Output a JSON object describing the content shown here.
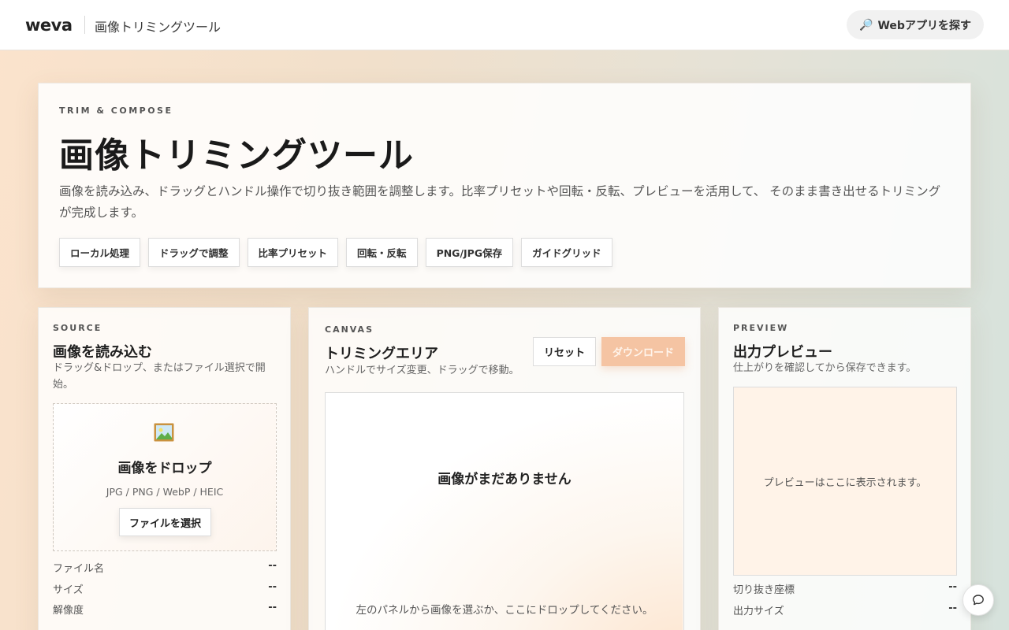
{
  "header": {
    "logo": "weva",
    "app_title": "画像トリミングツール",
    "explore_label": "Webアプリを探す",
    "explore_icon": "magnifier-icon"
  },
  "hero": {
    "eyebrow": "TRIM & COMPOSE",
    "title": "画像トリミングツール",
    "description": "画像を読み込み、ドラッグとハンドル操作で切り抜き範囲を調整します。比率プリセットや回転・反転、プレビューを活用して、 そのまま書き出せるトリミングが完成します。",
    "chips": [
      "ローカル処理",
      "ドラッグで調整",
      "比率プリセット",
      "回転・反転",
      "PNG/JPG保存",
      "ガイドグリッド"
    ]
  },
  "source": {
    "eyebrow": "SOURCE",
    "title": "画像を読み込む",
    "subtitle": "ドラッグ&ドロップ、またはファイル選択で開始。",
    "dropzone_icon": "picture-icon",
    "dropzone_title": "画像をドロップ",
    "dropzone_formats": "JPG / PNG / WebP / HEIC",
    "file_button": "ファイルを選択",
    "meta": [
      {
        "label": "ファイル名",
        "value": "--"
      },
      {
        "label": "サイズ",
        "value": "--"
      },
      {
        "label": "解像度",
        "value": "--"
      }
    ]
  },
  "canvas": {
    "eyebrow": "CANVAS",
    "title": "トリミングエリア",
    "subtitle": "ハンドルでサイズ変更、ドラッグで移動。",
    "reset_label": "リセット",
    "download_label": "ダウンロード",
    "empty_title": "画像がまだありません",
    "empty_hint": "左のパネルから画像を選ぶか、ここにドロップしてください。"
  },
  "preview": {
    "eyebrow": "PREVIEW",
    "title": "出力プレビュー",
    "subtitle": "仕上がりを確認してから保存できます。",
    "placeholder": "プレビューはここに表示されます。",
    "meta": [
      {
        "label": "切り抜き座標",
        "value": "--"
      },
      {
        "label": "出力サイズ",
        "value": "--"
      }
    ]
  },
  "chat_icon": "chat-bubble-icon",
  "colors": {
    "accent_disabled": "#f5c4a3",
    "preview_bg": "#fff3e8"
  }
}
